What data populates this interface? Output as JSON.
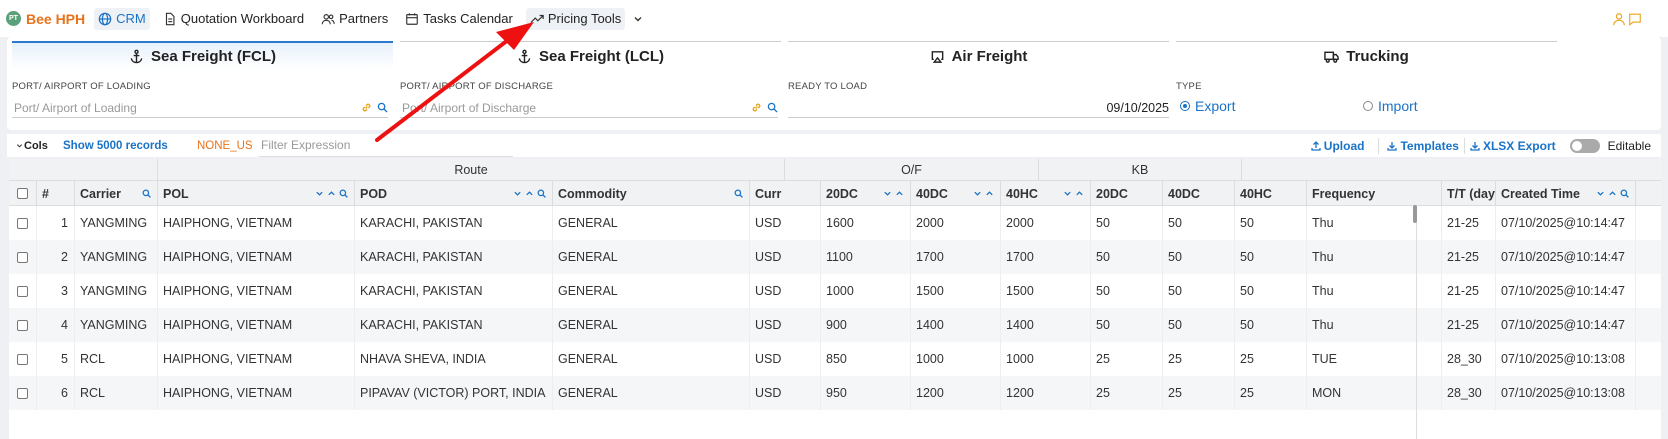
{
  "brand": {
    "initials": "PT",
    "name": "Bee HPH"
  },
  "nav": {
    "crm": "CRM",
    "quotation": "Quotation Workboard",
    "partners": "Partners",
    "tasks": "Tasks Calendar",
    "pricing": "Pricing Tools"
  },
  "tabs": {
    "fcl": "Sea Freight (FCL)",
    "lcl": "Sea Freight (LCL)",
    "air": "Air Freight",
    "trucking": "Trucking"
  },
  "search": {
    "pol_label": "PORT/ AIRPORT OF LOADING",
    "pol_placeholder": "Port/ Airport of Loading",
    "pod_label": "PORT/ AIRPORT OF DISCHARGE",
    "pod_placeholder": "Port/ Airport of Discharge",
    "ready_label": "READY TO LOAD",
    "ready_value": "09/10/2025",
    "type_label": "TYPE",
    "export_label": "Export",
    "import_label": "Import",
    "selected_type": "Export"
  },
  "toolbar": {
    "cols": "Cols",
    "show_records": "Show 5000 records",
    "none_us": "NONE_US",
    "filter_placeholder": "Filter Expression",
    "upload": "Upload",
    "templates": "Templates",
    "xlsx_export": "XLSX Export",
    "editable": "Editable"
  },
  "grid": {
    "groups": {
      "route": "Route",
      "of": "O/F",
      "kb": "KB"
    },
    "columns": {
      "index": "#",
      "carrier": "Carrier",
      "pol": "POL",
      "pod": "POD",
      "commodity": "Commodity",
      "curr": "Curr",
      "of20": "20DC",
      "of40dc": "40DC",
      "of40hc": "40HC",
      "kb20": "20DC",
      "kb40dc": "40DC",
      "kb40hc": "40HC",
      "frequency": "Frequency",
      "tt": "T/T (day",
      "created": "Created Time"
    },
    "rows": [
      {
        "idx": "1",
        "carrier": "YANGMING",
        "pol": "HAIPHONG, VIETNAM",
        "pod": "KARACHI, PAKISTAN",
        "commodity": "GENERAL",
        "curr": "USD",
        "of20": "1600",
        "of40dc": "2000",
        "of40hc": "2000",
        "kb20": "50",
        "kb40dc": "50",
        "kb40hc": "50",
        "freq": "Thu",
        "tt": "21-25",
        "created": "07/10/2025@10:14:47"
      },
      {
        "idx": "2",
        "carrier": "YANGMING",
        "pol": "HAIPHONG, VIETNAM",
        "pod": "KARACHI, PAKISTAN",
        "commodity": "GENERAL",
        "curr": "USD",
        "of20": "1100",
        "of40dc": "1700",
        "of40hc": "1700",
        "kb20": "50",
        "kb40dc": "50",
        "kb40hc": "50",
        "freq": "Thu",
        "tt": "21-25",
        "created": "07/10/2025@10:14:47"
      },
      {
        "idx": "3",
        "carrier": "YANGMING",
        "pol": "HAIPHONG, VIETNAM",
        "pod": "KARACHI, PAKISTAN",
        "commodity": "GENERAL",
        "curr": "USD",
        "of20": "1000",
        "of40dc": "1500",
        "of40hc": "1500",
        "kb20": "50",
        "kb40dc": "50",
        "kb40hc": "50",
        "freq": "Thu",
        "tt": "21-25",
        "created": "07/10/2025@10:14:47"
      },
      {
        "idx": "4",
        "carrier": "YANGMING",
        "pol": "HAIPHONG, VIETNAM",
        "pod": "KARACHI, PAKISTAN",
        "commodity": "GENERAL",
        "curr": "USD",
        "of20": "900",
        "of40dc": "1400",
        "of40hc": "1400",
        "kb20": "50",
        "kb40dc": "50",
        "kb40hc": "50",
        "freq": "Thu",
        "tt": "21-25",
        "created": "07/10/2025@10:14:47"
      },
      {
        "idx": "5",
        "carrier": "RCL",
        "pol": "HAIPHONG, VIETNAM",
        "pod": "NHAVA SHEVA, INDIA",
        "commodity": "GENERAL",
        "curr": "USD",
        "of20": "850",
        "of40dc": "1000",
        "of40hc": "1000",
        "kb20": "25",
        "kb40dc": "25",
        "kb40hc": "25",
        "freq": "TUE",
        "tt": "28_30",
        "created": "07/10/2025@10:13:08"
      },
      {
        "idx": "6",
        "carrier": "RCL",
        "pol": "HAIPHONG, VIETNAM",
        "pod": "PIPAVAV (VICTOR) PORT, INDIA",
        "commodity": "GENERAL",
        "curr": "USD",
        "of20": "950",
        "of40dc": "1200",
        "of40hc": "1200",
        "kb20": "25",
        "kb40dc": "25",
        "kb40hc": "25",
        "freq": "MON",
        "tt": "28_30",
        "created": "07/10/2025@10:13:08"
      }
    ]
  },
  "colors": {
    "brand": "#e8731c",
    "accent": "#1a73c6",
    "annotation_arrow": "#ee1111"
  }
}
